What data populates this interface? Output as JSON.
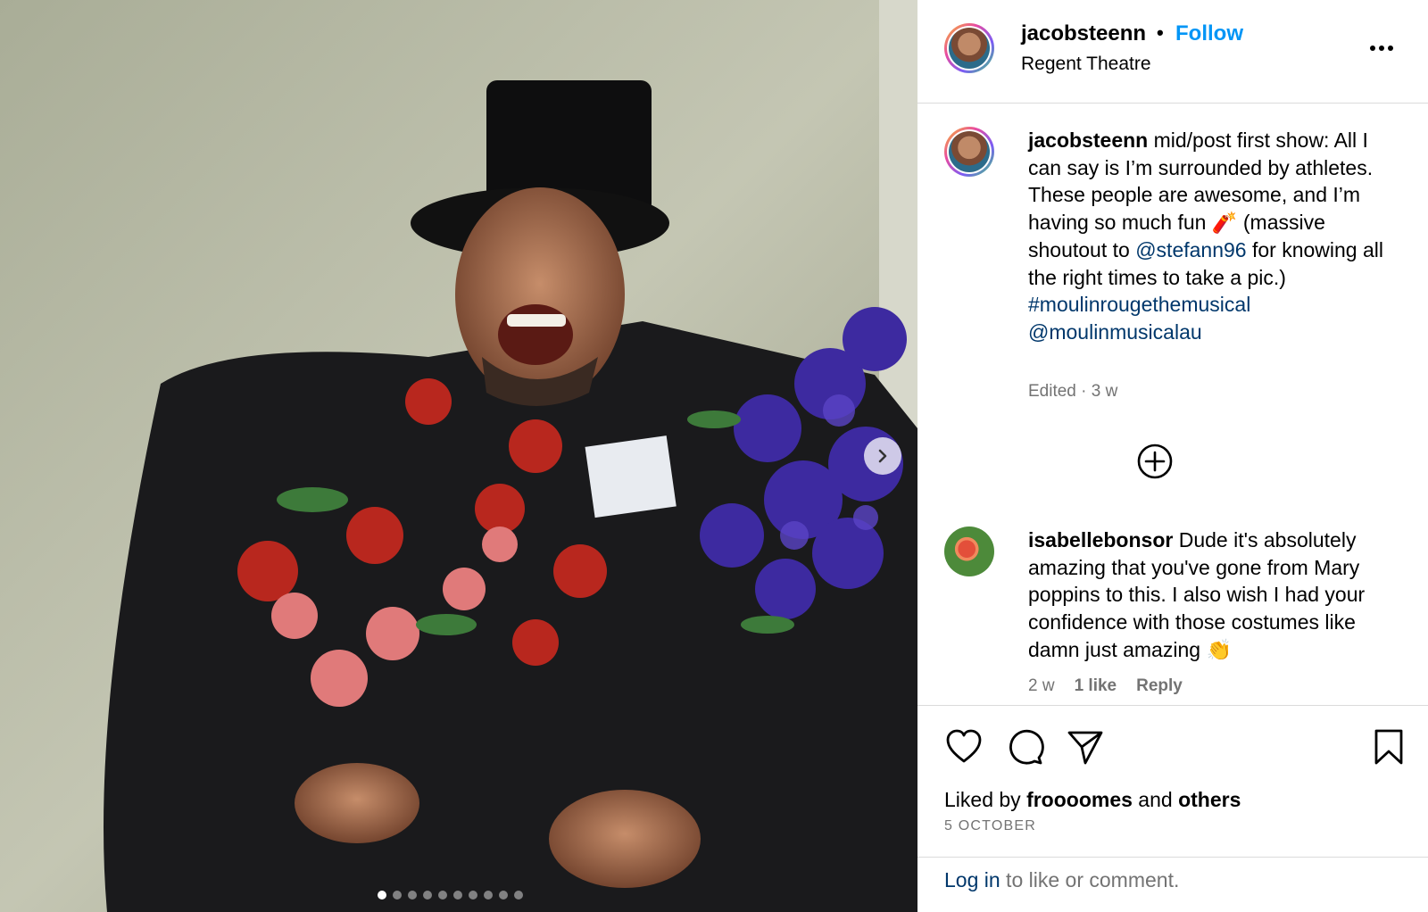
{
  "post": {
    "slide_count": 10,
    "active_slide": 1
  },
  "header": {
    "username": "jacobsteenn",
    "separator": "•",
    "follow_label": "Follow",
    "location": "Regent Theatre"
  },
  "caption": {
    "username": "jacobsteenn",
    "text_1": "mid/post first show: All I can say is I’m surrounded by athletes. These people are awesome, and I’m having so much fun ",
    "emoji_1": "🧨",
    "text_2": " (massive shoutout to ",
    "mention_1": "@stefann96",
    "text_3": " for knowing all the right times to take a pic.) ",
    "hashtag_1": "#moulinrougethemusical",
    "mention_2": "@moulinmusicalau",
    "meta": "Edited · 3 w"
  },
  "comment": {
    "username": "isabellebonsor",
    "text": "Dude it's absolutely amazing that you've gone from Mary poppins to this. I also wish I had your confidence with those costumes like damn just amazing ",
    "emoji": "👏",
    "time": "2 w",
    "likes": "1 like",
    "reply_label": "Reply"
  },
  "footer": {
    "liked_prefix": "Liked by ",
    "liked_user": "froooomes",
    "liked_and": " and ",
    "liked_others": "others",
    "date": "5 OCTOBER",
    "login_link": "Log in",
    "login_rest": " to like or comment."
  }
}
